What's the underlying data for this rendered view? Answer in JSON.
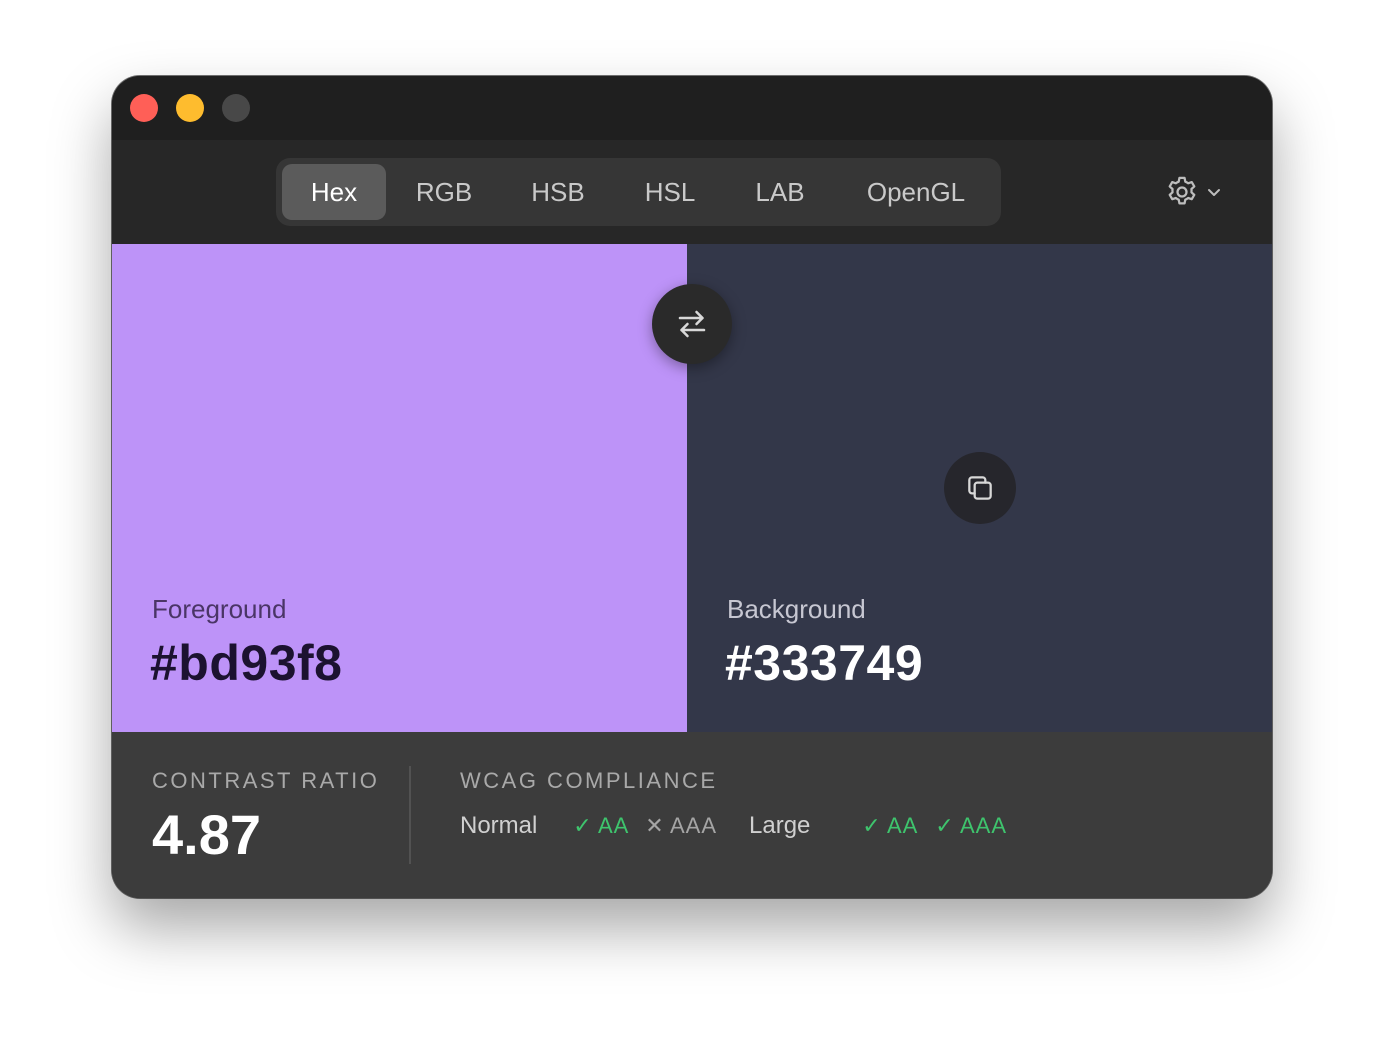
{
  "window": {
    "traffic_lights": [
      {
        "name": "close",
        "color": "#ff5f57"
      },
      {
        "name": "minimize",
        "color": "#febc2e"
      },
      {
        "name": "zoom",
        "color": "#484848"
      }
    ]
  },
  "toolbar": {
    "tabs": [
      {
        "label": "Hex",
        "active": true
      },
      {
        "label": "RGB",
        "active": false
      },
      {
        "label": "HSB",
        "active": false
      },
      {
        "label": "HSL",
        "active": false
      },
      {
        "label": "LAB",
        "active": false
      },
      {
        "label": "OpenGL",
        "active": false
      }
    ],
    "settings_icon": "gear-icon",
    "settings_menu_icon": "chevron-down-icon"
  },
  "foreground": {
    "label": "Foreground",
    "value": "#bd93f8",
    "color": "#bd93f8",
    "label_color": "#4a3566",
    "text_color": "#1c1230"
  },
  "background": {
    "label": "Background",
    "value": "#333749",
    "color": "#333749",
    "label_color": "#c7c7d2",
    "text_color": "#ffffff"
  },
  "swap_icon": "swap-arrows-icon",
  "copy_icon": "copy-icon",
  "contrast": {
    "heading": "CONTRAST RATIO",
    "value": "4.87"
  },
  "wcag": {
    "heading": "WCAG COMPLIANCE",
    "normal": {
      "label": "Normal",
      "aa": {
        "text": "AA",
        "pass": true
      },
      "aaa": {
        "text": "AAA",
        "pass": false
      }
    },
    "large": {
      "label": "Large",
      "aa": {
        "text": "AA",
        "pass": true
      },
      "aaa": {
        "text": "AAA",
        "pass": true
      }
    },
    "pass_color": "#3ec46d",
    "fail_color": "#a5a5a5"
  }
}
